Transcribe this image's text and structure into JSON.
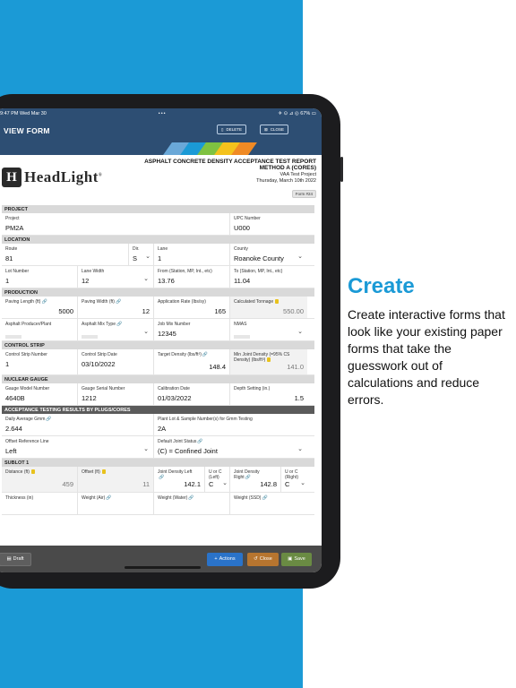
{
  "marketing": {
    "title": "Create",
    "body": "Create interactive forms that look like your existing paper forms that take the guesswork out of calculations and reduce errors."
  },
  "status": {
    "time": "9:47 PM",
    "date": "Wed Mar 30",
    "dots": "•••",
    "signal": "✈ ⊙ ⊿ ◎",
    "battery": "67% ▭"
  },
  "appbar": {
    "title": "VIEW FORM",
    "delete_label": "DELETE",
    "close_label": "CLOSE"
  },
  "brand": {
    "logo_letter": "H",
    "logo_text": "HeadLight",
    "logo_mark": "®"
  },
  "report": {
    "line1": "ASPHALT CONCRETE DENSITY ACCEPTANCE TEST REPORT",
    "line2": "METHOD A (CORES)",
    "project": "VAA Test Project",
    "date": "Thursday, March 10th 2022",
    "form_no": "Form #24"
  },
  "sections": {
    "project": "PROJECT",
    "location": "LOCATION",
    "production": "PRODUCTION",
    "control_strip": "CONTROL STRIP",
    "nuclear_gauge": "NUCLEAR GAUGE",
    "acceptance": "ACCEPTANCE TESTING RESULTS BY PLUGS/CORES",
    "sublot": "SUBLOT 1"
  },
  "fields": {
    "project": {
      "label": "Project",
      "value": "PM2A"
    },
    "upc": {
      "label": "UPC Number",
      "value": "U000"
    },
    "route": {
      "label": "Route",
      "value": "81"
    },
    "dir": {
      "label": "Dir.",
      "value": "S"
    },
    "lane": {
      "label": "Lane",
      "value": "1"
    },
    "county": {
      "label": "County",
      "value": "Roanoke County"
    },
    "lot": {
      "label": "Lot Number",
      "value": "1"
    },
    "lane_width": {
      "label": "Lane Width",
      "value": "12"
    },
    "from": {
      "label": "From (Station, MP, Int., etc)",
      "value": "13.76"
    },
    "to": {
      "label": "To (Station, MP, Int., etc)",
      "value": "11.04"
    },
    "paving_length": {
      "label": "Paving Length (ft)",
      "value": "5000"
    },
    "paving_width": {
      "label": "Paving Width (ft)",
      "value": "12"
    },
    "app_rate": {
      "label": "Application Rate (lbs/sy)",
      "value": "165"
    },
    "calc_tonnage": {
      "label": "Calculated Tonnage",
      "value": "550.00"
    },
    "producer": {
      "label": "Asphalt Producer/Plant"
    },
    "mix_type": {
      "label": "Asphalt Mix Type"
    },
    "job_mix": {
      "label": "Job Mix Number",
      "value": "12345"
    },
    "nmas": {
      "label": "NMAS"
    },
    "strip_no": {
      "label": "Control Strip Number",
      "value": "1"
    },
    "strip_date": {
      "label": "Control Strip Date",
      "value": "03/10/2022"
    },
    "target_density": {
      "label": "Target Density (lbs/ft³)",
      "value": "148.4"
    },
    "min_density": {
      "label": "Min Joint Density (=95% CS Density) (lbs/ft³)",
      "value": "141.0"
    },
    "gauge_model": {
      "label": "Gauge Model Number",
      "value": "4640B"
    },
    "gauge_serial": {
      "label": "Gauge Serial Number",
      "value": "1212"
    },
    "calib_date": {
      "label": "Calibration Date",
      "value": "01/03/2022"
    },
    "depth": {
      "label": "Depth Setting (in.)",
      "value": "1.5"
    },
    "gmm": {
      "label": "Daily Average Gmm",
      "value": "2.644"
    },
    "plant_lot": {
      "label": "Plant Lot & Sample Number(s) for Gmm Testing",
      "value": "2A"
    },
    "offset_line": {
      "label": "Offset Reference Line",
      "value": "Left"
    },
    "joint_status": {
      "label": "Default Joint Status",
      "value": "(C) = Confined Joint"
    },
    "distance": {
      "label": "Distance (ft)",
      "value": "459"
    },
    "offset": {
      "label": "Offset (ft)",
      "value": "11"
    },
    "jd_left": {
      "label": "Joint Density Left",
      "value": "142.1"
    },
    "uc_left": {
      "label": "U or C (Left)",
      "value": "C"
    },
    "jd_right": {
      "label": "Joint Density Right",
      "value": "142.8"
    },
    "uc_right": {
      "label": "U or C (Right)",
      "value": "C"
    },
    "thickness": {
      "label": "Thickness (in)"
    },
    "w_air": {
      "label": "Weight (Air)"
    },
    "w_water": {
      "label": "Weight (Water)"
    },
    "w_ssd": {
      "label": "Weight (SSD)"
    }
  },
  "bottombar": {
    "draft": "Draft",
    "actions": "Actions",
    "close": "Close",
    "save": "Save"
  },
  "colors": {
    "band": "#1b9ad6",
    "appbar": "#2d4e73",
    "actions": "#2a73c9",
    "close": "#b7752f",
    "save": "#6a8b43"
  }
}
